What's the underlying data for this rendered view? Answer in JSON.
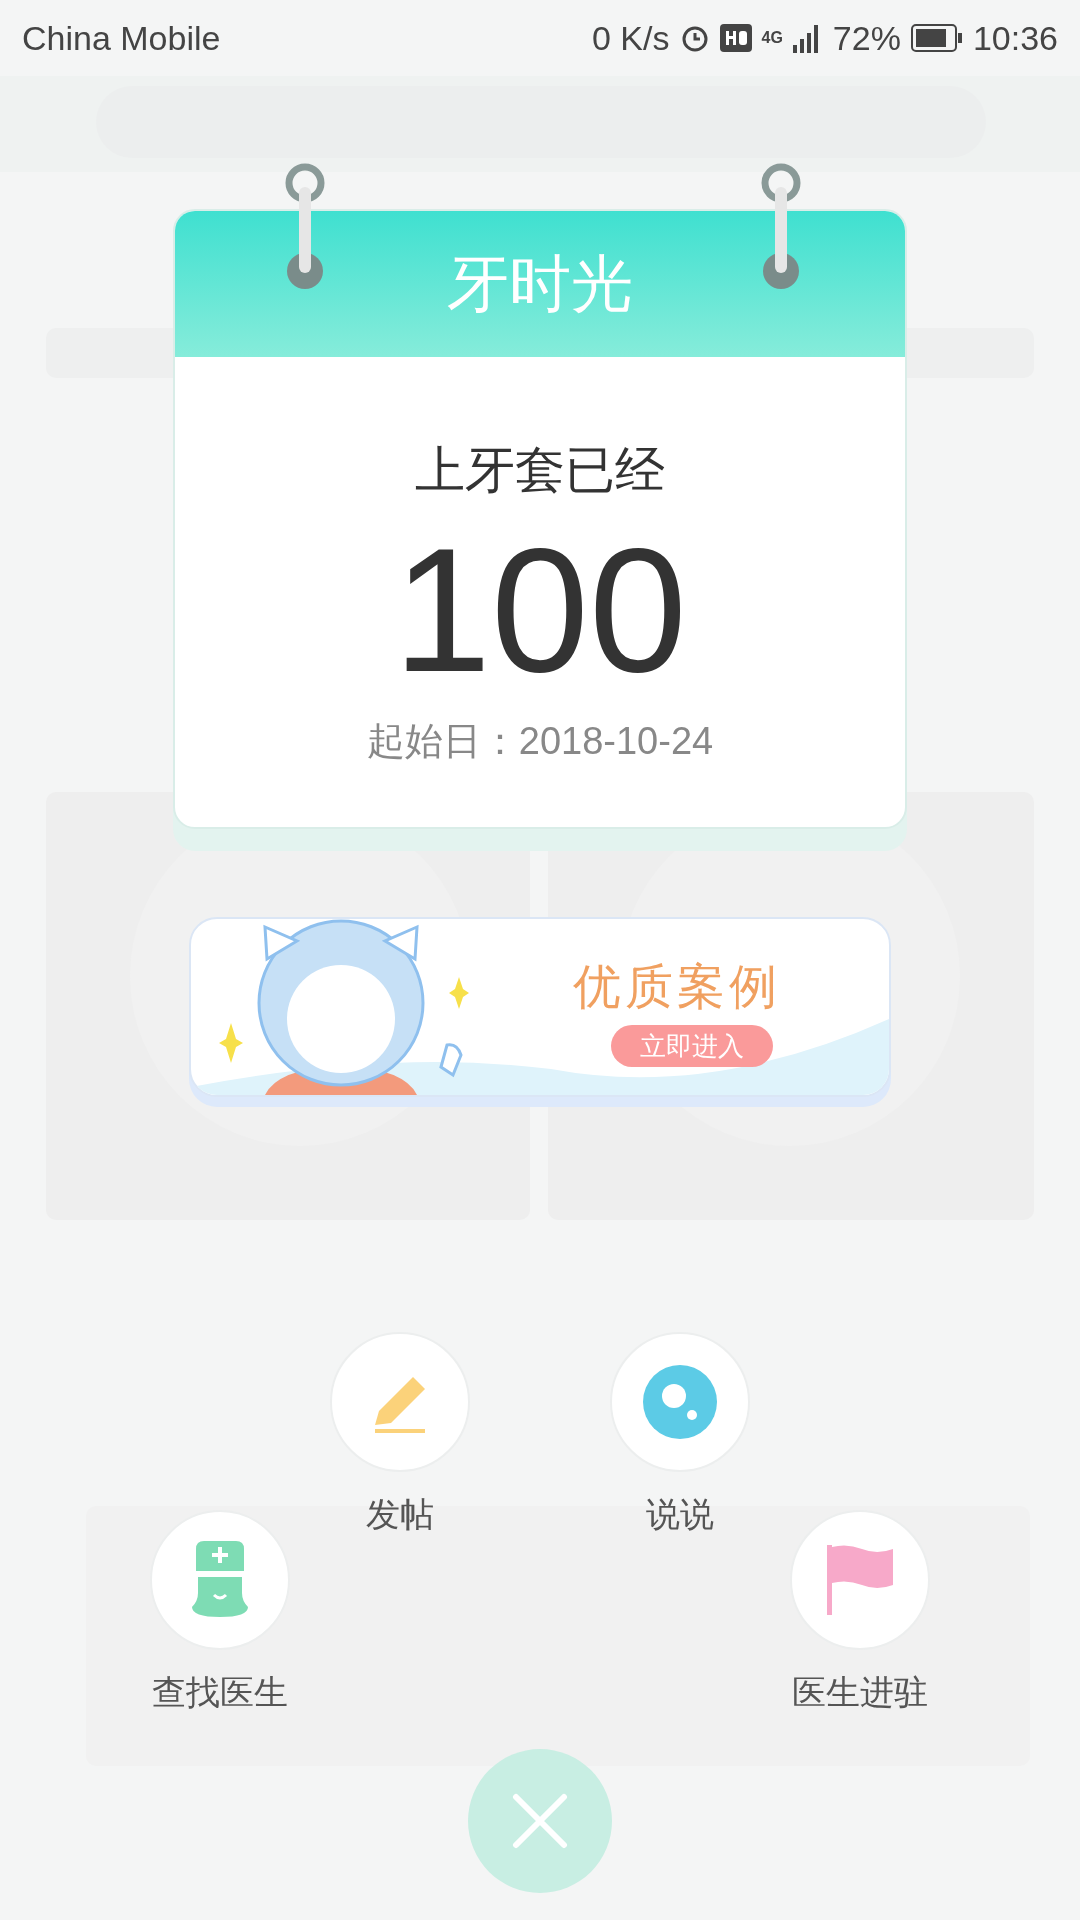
{
  "status_bar": {
    "carrier": "China Mobile",
    "speed": "0 K/s",
    "network": "4G",
    "battery": "72%",
    "time": "10:36"
  },
  "calendar": {
    "title": "牙时光",
    "caption": "上牙套已经",
    "days": "100",
    "start_date": "起始日：2018-10-24"
  },
  "banner": {
    "title": "优质案例",
    "button": "立即进入"
  },
  "actions": [
    {
      "kind": "post",
      "label": "发帖"
    },
    {
      "kind": "talk",
      "label": "说说"
    },
    {
      "kind": "doctor",
      "label": "查找医生"
    },
    {
      "kind": "flag",
      "label": "医生进驻"
    }
  ]
}
